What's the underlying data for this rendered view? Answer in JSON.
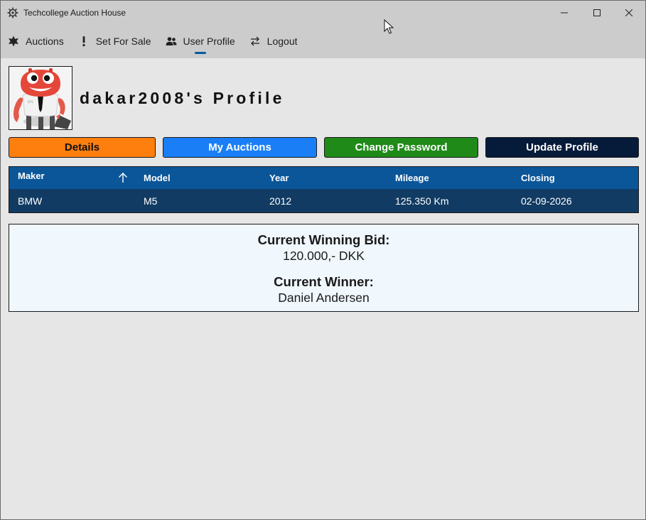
{
  "window": {
    "title": "Techcollege Auction House"
  },
  "nav": {
    "items": [
      {
        "label": "Auctions",
        "icon": "gear-star-icon"
      },
      {
        "label": "Set For Sale",
        "icon": "exclamation-icon"
      },
      {
        "label": "User Profile",
        "icon": "users-icon",
        "active": true
      },
      {
        "label": "Logout",
        "icon": "swap-arrows-icon"
      }
    ]
  },
  "profile": {
    "title": "dakar2008's Profile"
  },
  "buttons": {
    "details": "Details",
    "my_auctions": "My Auctions",
    "change_password": "Change Password",
    "update_profile": "Update Profile"
  },
  "table": {
    "columns": [
      "Maker",
      "Model",
      "Year",
      "Mileage",
      "Closing"
    ],
    "rows": [
      {
        "maker": "BMW",
        "model": "M5",
        "year": "2012",
        "mileage": "125.350 Km",
        "closing": "02-09-2026"
      }
    ]
  },
  "bid": {
    "winning_label": "Current Winning Bid:",
    "winning_value": "120.000,- DKK",
    "winner_label": "Current Winner:",
    "winner_value": "Daniel Andersen"
  },
  "colors": {
    "chrome": "#cccccc",
    "content_bg": "#e6e6e6",
    "details_btn": "#ff7f0e",
    "my_auctions_btn": "#1a7ff6",
    "change_password_btn": "#1f8a18",
    "update_profile_btn": "#061a3a",
    "grid_header": "#0b5699",
    "grid_row": "#113b63",
    "accent": "#005a9e"
  }
}
